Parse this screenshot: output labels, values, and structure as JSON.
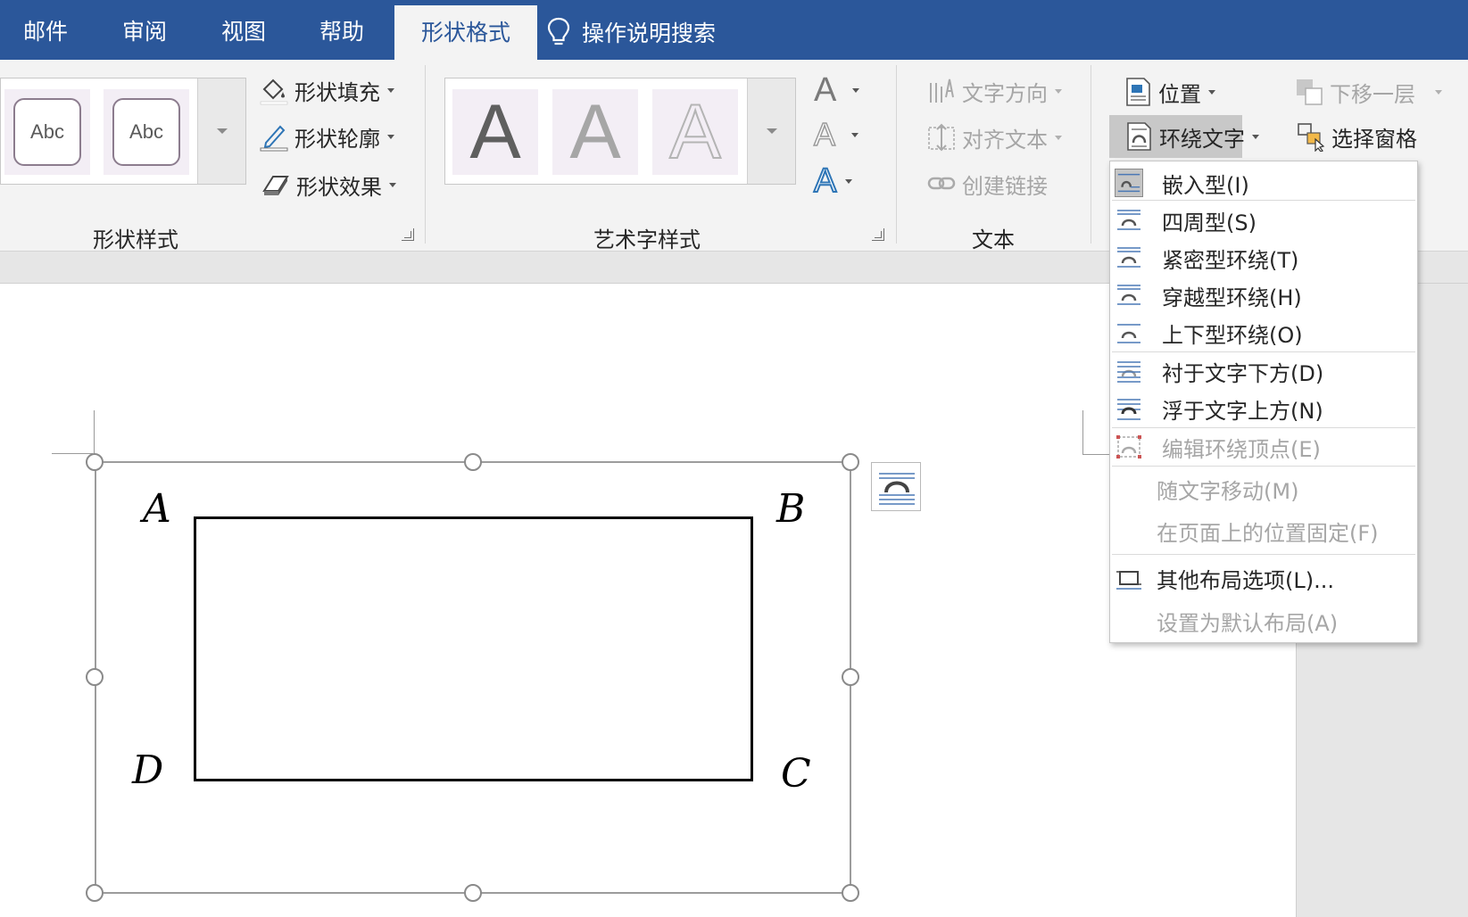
{
  "tabs": {
    "mail": "邮件",
    "review": "审阅",
    "view": "视图",
    "help": "帮助",
    "shape_format": "形状格式"
  },
  "tell_me": "操作说明搜索",
  "shape_styles": {
    "thumb1": "Abc",
    "thumb2": "Abc",
    "fill": "形状填充",
    "outline": "形状轮廓",
    "effects": "形状效果",
    "label": "形状样式"
  },
  "wordart": {
    "letter1": "A",
    "letter2": "A",
    "letter3": "A",
    "fill_a": "A",
    "outline_a": "A",
    "effects_a": "A",
    "label": "艺术字样式"
  },
  "text_group": {
    "direction": "文字方向",
    "align": "对齐文本",
    "link": "创建链接",
    "label": "文本"
  },
  "arrange": {
    "position": "位置",
    "wrap_text": "环绕文字",
    "send_backward": "下移一层",
    "selection_pane": "选择窗格"
  },
  "wrap_menu": {
    "inline": "嵌入型(I)",
    "square": "四周型(S)",
    "tight": "紧密型环绕(T)",
    "through": "穿越型环绕(H)",
    "top_bottom": "上下型环绕(O)",
    "behind": "衬于文字下方(D)",
    "in_front": "浮于文字上方(N)",
    "edit_points": "编辑环绕顶点(E)",
    "move_with_text": "随文字移动(M)",
    "fix_position": "在页面上的位置固定(F)",
    "more_options": "其他布局选项(L)...",
    "set_default": "设置为默认布局(A)"
  },
  "figure": {
    "a": "A",
    "b": "B",
    "c": "C",
    "d": "D"
  },
  "colors": {
    "title_bar": "#2b579a",
    "ribbon": "#f3f3f3",
    "accent_blue": "#2e75b6"
  }
}
